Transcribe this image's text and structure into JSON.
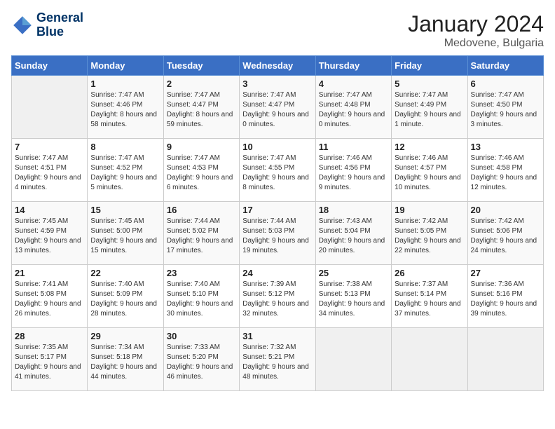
{
  "logo": {
    "line1": "General",
    "line2": "Blue"
  },
  "title": "January 2024",
  "location": "Medovene, Bulgaria",
  "days_of_week": [
    "Sunday",
    "Monday",
    "Tuesday",
    "Wednesday",
    "Thursday",
    "Friday",
    "Saturday"
  ],
  "weeks": [
    [
      {
        "day": "",
        "sunrise": "",
        "sunset": "",
        "daylight": ""
      },
      {
        "day": "1",
        "sunrise": "Sunrise: 7:47 AM",
        "sunset": "Sunset: 4:46 PM",
        "daylight": "Daylight: 8 hours and 58 minutes."
      },
      {
        "day": "2",
        "sunrise": "Sunrise: 7:47 AM",
        "sunset": "Sunset: 4:47 PM",
        "daylight": "Daylight: 8 hours and 59 minutes."
      },
      {
        "day": "3",
        "sunrise": "Sunrise: 7:47 AM",
        "sunset": "Sunset: 4:47 PM",
        "daylight": "Daylight: 9 hours and 0 minutes."
      },
      {
        "day": "4",
        "sunrise": "Sunrise: 7:47 AM",
        "sunset": "Sunset: 4:48 PM",
        "daylight": "Daylight: 9 hours and 0 minutes."
      },
      {
        "day": "5",
        "sunrise": "Sunrise: 7:47 AM",
        "sunset": "Sunset: 4:49 PM",
        "daylight": "Daylight: 9 hours and 1 minute."
      },
      {
        "day": "6",
        "sunrise": "Sunrise: 7:47 AM",
        "sunset": "Sunset: 4:50 PM",
        "daylight": "Daylight: 9 hours and 3 minutes."
      }
    ],
    [
      {
        "day": "7",
        "sunrise": "Sunrise: 7:47 AM",
        "sunset": "Sunset: 4:51 PM",
        "daylight": "Daylight: 9 hours and 4 minutes."
      },
      {
        "day": "8",
        "sunrise": "Sunrise: 7:47 AM",
        "sunset": "Sunset: 4:52 PM",
        "daylight": "Daylight: 9 hours and 5 minutes."
      },
      {
        "day": "9",
        "sunrise": "Sunrise: 7:47 AM",
        "sunset": "Sunset: 4:53 PM",
        "daylight": "Daylight: 9 hours and 6 minutes."
      },
      {
        "day": "10",
        "sunrise": "Sunrise: 7:47 AM",
        "sunset": "Sunset: 4:55 PM",
        "daylight": "Daylight: 9 hours and 8 minutes."
      },
      {
        "day": "11",
        "sunrise": "Sunrise: 7:46 AM",
        "sunset": "Sunset: 4:56 PM",
        "daylight": "Daylight: 9 hours and 9 minutes."
      },
      {
        "day": "12",
        "sunrise": "Sunrise: 7:46 AM",
        "sunset": "Sunset: 4:57 PM",
        "daylight": "Daylight: 9 hours and 10 minutes."
      },
      {
        "day": "13",
        "sunrise": "Sunrise: 7:46 AM",
        "sunset": "Sunset: 4:58 PM",
        "daylight": "Daylight: 9 hours and 12 minutes."
      }
    ],
    [
      {
        "day": "14",
        "sunrise": "Sunrise: 7:45 AM",
        "sunset": "Sunset: 4:59 PM",
        "daylight": "Daylight: 9 hours and 13 minutes."
      },
      {
        "day": "15",
        "sunrise": "Sunrise: 7:45 AM",
        "sunset": "Sunset: 5:00 PM",
        "daylight": "Daylight: 9 hours and 15 minutes."
      },
      {
        "day": "16",
        "sunrise": "Sunrise: 7:44 AM",
        "sunset": "Sunset: 5:02 PM",
        "daylight": "Daylight: 9 hours and 17 minutes."
      },
      {
        "day": "17",
        "sunrise": "Sunrise: 7:44 AM",
        "sunset": "Sunset: 5:03 PM",
        "daylight": "Daylight: 9 hours and 19 minutes."
      },
      {
        "day": "18",
        "sunrise": "Sunrise: 7:43 AM",
        "sunset": "Sunset: 5:04 PM",
        "daylight": "Daylight: 9 hours and 20 minutes."
      },
      {
        "day": "19",
        "sunrise": "Sunrise: 7:42 AM",
        "sunset": "Sunset: 5:05 PM",
        "daylight": "Daylight: 9 hours and 22 minutes."
      },
      {
        "day": "20",
        "sunrise": "Sunrise: 7:42 AM",
        "sunset": "Sunset: 5:06 PM",
        "daylight": "Daylight: 9 hours and 24 minutes."
      }
    ],
    [
      {
        "day": "21",
        "sunrise": "Sunrise: 7:41 AM",
        "sunset": "Sunset: 5:08 PM",
        "daylight": "Daylight: 9 hours and 26 minutes."
      },
      {
        "day": "22",
        "sunrise": "Sunrise: 7:40 AM",
        "sunset": "Sunset: 5:09 PM",
        "daylight": "Daylight: 9 hours and 28 minutes."
      },
      {
        "day": "23",
        "sunrise": "Sunrise: 7:40 AM",
        "sunset": "Sunset: 5:10 PM",
        "daylight": "Daylight: 9 hours and 30 minutes."
      },
      {
        "day": "24",
        "sunrise": "Sunrise: 7:39 AM",
        "sunset": "Sunset: 5:12 PM",
        "daylight": "Daylight: 9 hours and 32 minutes."
      },
      {
        "day": "25",
        "sunrise": "Sunrise: 7:38 AM",
        "sunset": "Sunset: 5:13 PM",
        "daylight": "Daylight: 9 hours and 34 minutes."
      },
      {
        "day": "26",
        "sunrise": "Sunrise: 7:37 AM",
        "sunset": "Sunset: 5:14 PM",
        "daylight": "Daylight: 9 hours and 37 minutes."
      },
      {
        "day": "27",
        "sunrise": "Sunrise: 7:36 AM",
        "sunset": "Sunset: 5:16 PM",
        "daylight": "Daylight: 9 hours and 39 minutes."
      }
    ],
    [
      {
        "day": "28",
        "sunrise": "Sunrise: 7:35 AM",
        "sunset": "Sunset: 5:17 PM",
        "daylight": "Daylight: 9 hours and 41 minutes."
      },
      {
        "day": "29",
        "sunrise": "Sunrise: 7:34 AM",
        "sunset": "Sunset: 5:18 PM",
        "daylight": "Daylight: 9 hours and 44 minutes."
      },
      {
        "day": "30",
        "sunrise": "Sunrise: 7:33 AM",
        "sunset": "Sunset: 5:20 PM",
        "daylight": "Daylight: 9 hours and 46 minutes."
      },
      {
        "day": "31",
        "sunrise": "Sunrise: 7:32 AM",
        "sunset": "Sunset: 5:21 PM",
        "daylight": "Daylight: 9 hours and 48 minutes."
      },
      {
        "day": "",
        "sunrise": "",
        "sunset": "",
        "daylight": ""
      },
      {
        "day": "",
        "sunrise": "",
        "sunset": "",
        "daylight": ""
      },
      {
        "day": "",
        "sunrise": "",
        "sunset": "",
        "daylight": ""
      }
    ]
  ]
}
